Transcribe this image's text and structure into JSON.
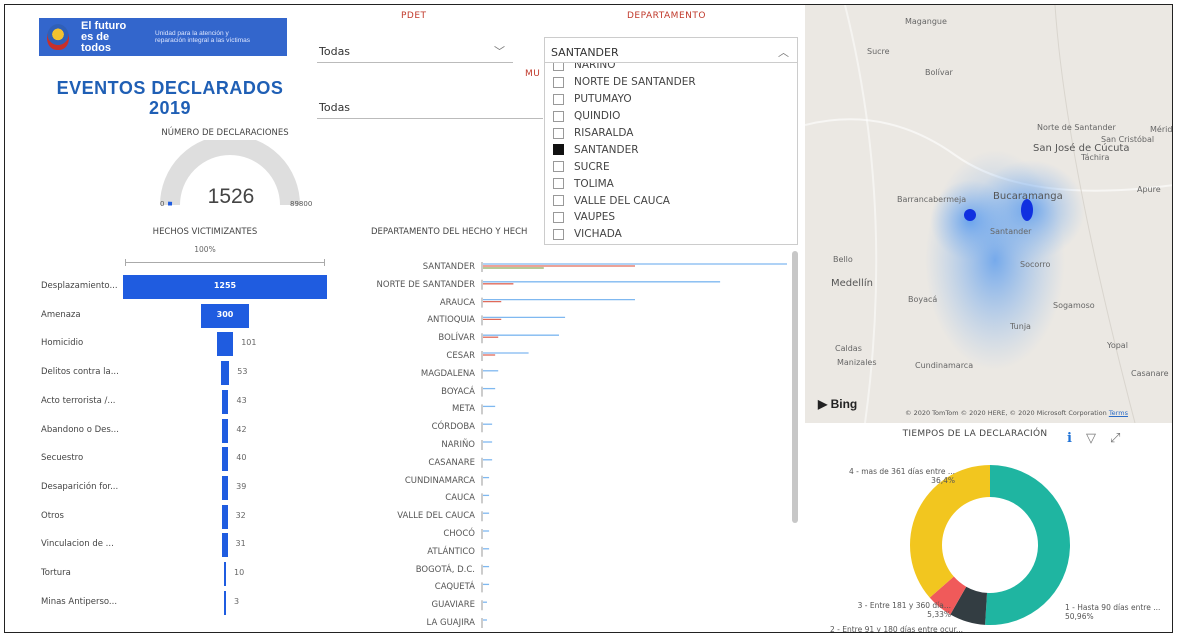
{
  "header": {
    "brand_title": "El futuro es de todos",
    "brand_subtitle": "Unidad para la atención y reparación integral a las víctimas",
    "page_title_line1": "EVENTOS DECLARADOS",
    "page_title_line2": "2019"
  },
  "gauge": {
    "title": "NÚMERO DE DECLARACIONES",
    "value": "1526",
    "min": "0",
    "max": "89800",
    "value_number": 1526,
    "max_number": 89800
  },
  "slicers": {
    "pdet_label": "PDET",
    "pdet_value": "Todas",
    "departamento_label": "DEPARTAMENTO",
    "departamento_value": "SANTANDER",
    "municipio_label_partial": "MU",
    "municipio_value": "Todas",
    "dept_options": [
      {
        "label": "NARIÑO",
        "checked": false
      },
      {
        "label": "NORTE DE SANTANDER",
        "checked": false
      },
      {
        "label": "PUTUMAYO",
        "checked": false
      },
      {
        "label": "QUINDIO",
        "checked": false
      },
      {
        "label": "RISARALDA",
        "checked": false
      },
      {
        "label": "SANTANDER",
        "checked": true
      },
      {
        "label": "SUCRE",
        "checked": false
      },
      {
        "label": "TOLIMA",
        "checked": false
      },
      {
        "label": "VALLE DEL CAUCA",
        "checked": false
      },
      {
        "label": "VAUPES",
        "checked": false
      },
      {
        "label": "VICHADA",
        "checked": false
      }
    ]
  },
  "funnel": {
    "title": "HECHOS VICTIMIZANTES",
    "pct_label": "100%",
    "rows": [
      {
        "label": "Desplazamiento...",
        "value": "1255",
        "num": 1255
      },
      {
        "label": "Amenaza",
        "value": "300",
        "num": 300
      },
      {
        "label": "Homicidio",
        "value": "101",
        "num": 101
      },
      {
        "label": "Delitos contra la...",
        "value": "53",
        "num": 53
      },
      {
        "label": "Acto terrorista /...",
        "value": "43",
        "num": 43
      },
      {
        "label": "Abandono o Des...",
        "value": "42",
        "num": 42
      },
      {
        "label": "Secuestro",
        "value": "40",
        "num": 40
      },
      {
        "label": "Desaparición for...",
        "value": "39",
        "num": 39
      },
      {
        "label": "Otros",
        "value": "32",
        "num": 32
      },
      {
        "label": "Vinculacion de ...",
        "value": "31",
        "num": 31
      },
      {
        "label": "Tortura",
        "value": "10",
        "num": 10
      },
      {
        "label": "Minas Antiperso...",
        "value": "3",
        "num": 3
      }
    ]
  },
  "dept_chart": {
    "title": "DEPARTAMENTO DEL HECHO Y HECH",
    "rows": [
      {
        "label": "SANTANDER",
        "lines": [
          1.0,
          0.5,
          0.2
        ]
      },
      {
        "label": "NORTE DE SANTANDER",
        "lines": [
          0.78,
          0.1
        ]
      },
      {
        "label": "ARAUCA",
        "lines": [
          0.5,
          0.06
        ]
      },
      {
        "label": "ANTIOQUIA",
        "lines": [
          0.27,
          0.06
        ]
      },
      {
        "label": "BOLÍVAR",
        "lines": [
          0.25,
          0.05
        ]
      },
      {
        "label": "CESAR",
        "lines": [
          0.15,
          0.04
        ]
      },
      {
        "label": "MAGDALENA",
        "lines": [
          0.05
        ]
      },
      {
        "label": "BOYACÁ",
        "lines": [
          0.04
        ]
      },
      {
        "label": "META",
        "lines": [
          0.04
        ]
      },
      {
        "label": "CÓRDOBA",
        "lines": [
          0.03
        ]
      },
      {
        "label": "NARIÑO",
        "lines": [
          0.03
        ]
      },
      {
        "label": "CASANARE",
        "lines": [
          0.03
        ]
      },
      {
        "label": "CUNDINAMARCA",
        "lines": [
          0.02
        ]
      },
      {
        "label": "CAUCA",
        "lines": [
          0.02
        ]
      },
      {
        "label": "VALLE DEL CAUCA",
        "lines": [
          0.02
        ]
      },
      {
        "label": "CHOCÓ",
        "lines": [
          0.02
        ]
      },
      {
        "label": "ATLÁNTICO",
        "lines": [
          0.02
        ]
      },
      {
        "label": "BOGOTÁ, D.C.",
        "lines": [
          0.02
        ]
      },
      {
        "label": "CAQUETÁ",
        "lines": [
          0.02
        ]
      },
      {
        "label": "GUAVIARE",
        "lines": [
          0.01
        ]
      },
      {
        "label": "LA GUAJIRA",
        "lines": [
          0.01
        ]
      }
    ]
  },
  "map": {
    "places": [
      "Magangue",
      "Sucre",
      "Bolívar",
      "Norte de Santander",
      "San José de Cúcuta",
      "Táchira",
      "San Cristóbal",
      "Mérid",
      "Apure",
      "Barrancabermeja",
      "Bucaramanga",
      "Santander",
      "Bello",
      "Medellín",
      "Socorro",
      "Boyacá",
      "Sogamoso",
      "Tunja",
      "Yopal",
      "Caldas",
      "Manizales",
      "Cundinamarca",
      "Casanare"
    ],
    "bing_label": "Bing",
    "copyright": "© 2020 TomTom © 2020 HERE, © 2020 Microsoft Corporation",
    "terms": "Terms"
  },
  "donut": {
    "title": "TIEMPOS DE LA DECLARACIÓN",
    "segments": [
      {
        "label": "1 - Hasta 90 días entre ...",
        "pct": "50,96%",
        "value": 50.96,
        "color": "#1fb5a1"
      },
      {
        "label": "2 - Entre 91 y 180 días entre ocur...",
        "pct": "7,26%",
        "value": 7.26,
        "color": "#333d42"
      },
      {
        "label": "3 - Entre 181 y 360 día...",
        "pct": "5,33%",
        "value": 5.33,
        "color": "#f05a5a"
      },
      {
        "label": "4 - mas de 361 días entre ...",
        "pct": "36,4%",
        "value": 36.4,
        "color": "#f2c61f"
      }
    ]
  }
}
